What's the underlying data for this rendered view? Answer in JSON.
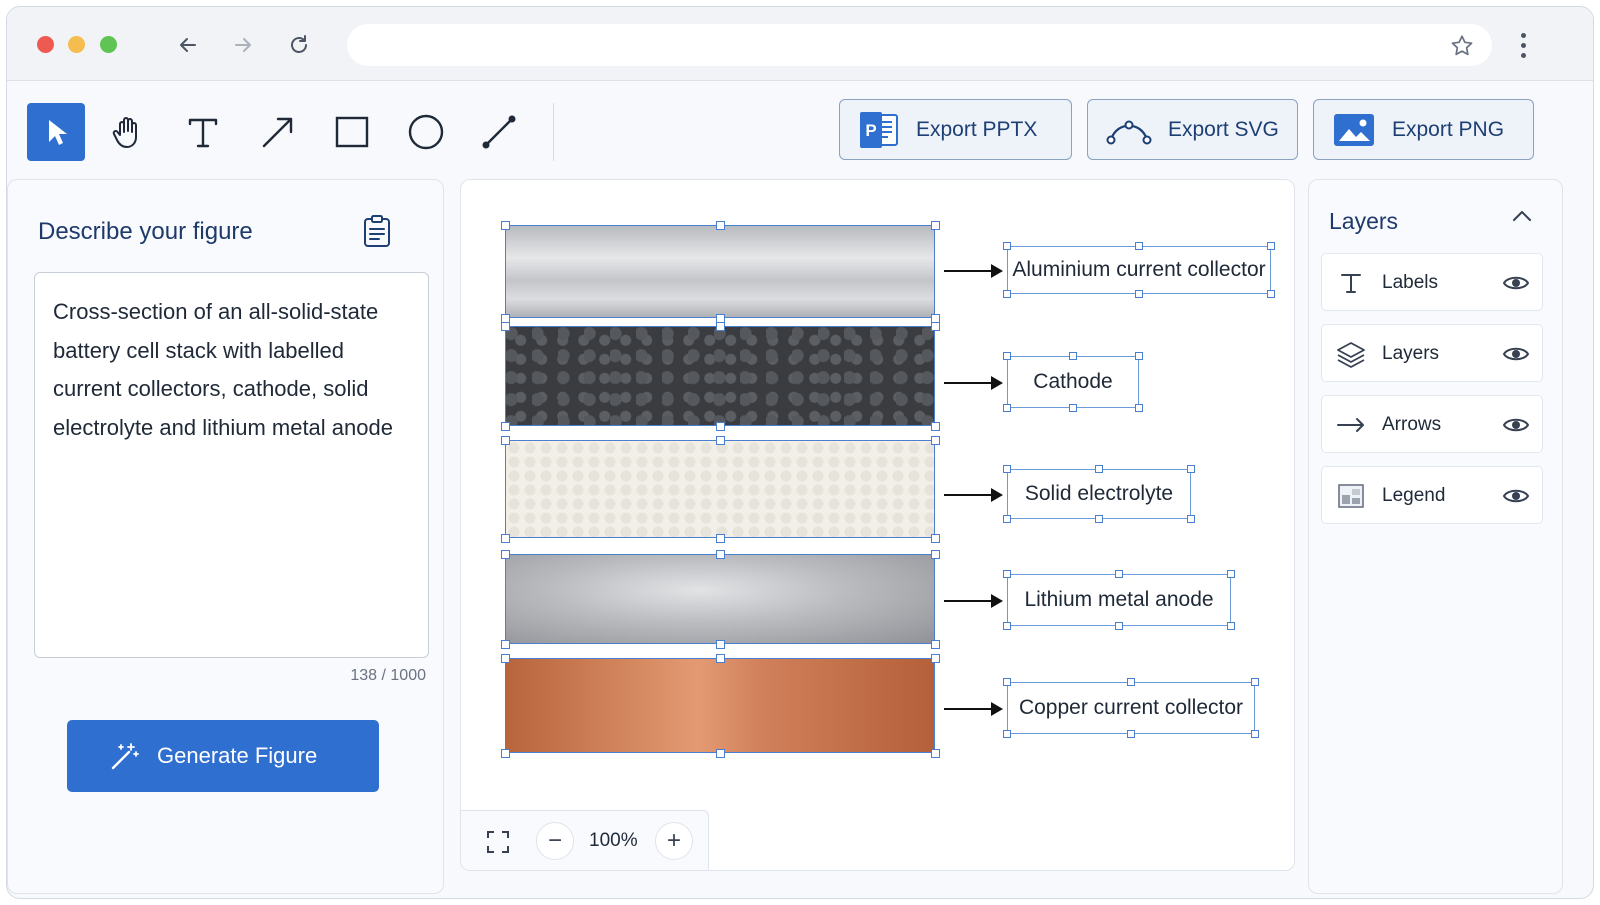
{
  "toolbar": {
    "tools": [
      "select",
      "hand",
      "text",
      "arrow",
      "rectangle",
      "circle",
      "line"
    ],
    "export_pptx": "Export PPTX",
    "export_svg": "Export SVG",
    "export_png": "Export PNG"
  },
  "left_panel": {
    "title": "Describe your figure",
    "description": "Cross-section of an all-solid-state battery cell stack with labelled current collectors, cathode, solid electrolyte and lithium metal anode",
    "char_count": "138 / 1000",
    "generate_label": "Generate Figure"
  },
  "canvas": {
    "labels": [
      "Aluminium current collector",
      "Cathode",
      "Solid electrolyte",
      "Lithium metal anode",
      "Copper current collector"
    ],
    "zoom": "100%"
  },
  "layers_panel": {
    "title": "Layers",
    "items": [
      {
        "label": "Labels",
        "icon": "text-icon"
      },
      {
        "label": "Layers",
        "icon": "layers-icon"
      },
      {
        "label": "Arrows",
        "icon": "arrow-icon"
      },
      {
        "label": "Legend",
        "icon": "legend-icon"
      }
    ]
  },
  "colors": {
    "accent": "#2f6fd0",
    "aluminium": "#c9cbcf",
    "cathode": "#3a3c40",
    "electrolyte": "#f1efe8",
    "lithium": "#a9abaf",
    "copper": "#c8744a"
  }
}
